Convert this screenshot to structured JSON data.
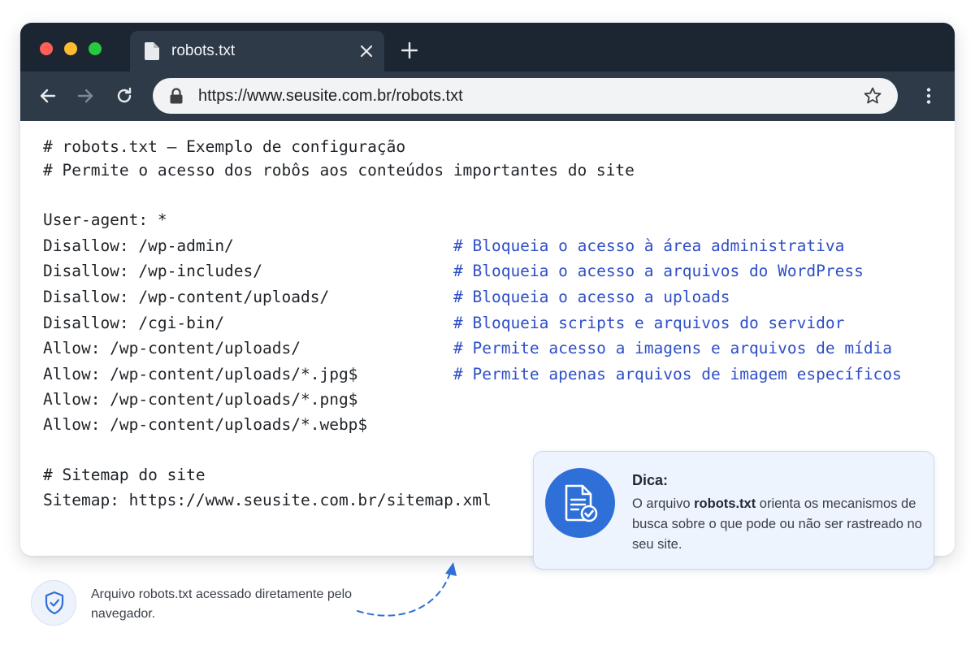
{
  "window": {
    "tab": {
      "title": "robots.txt",
      "icon": "file-icon"
    },
    "address_bar": {
      "url": "https://www.seusite.com.br/robots.txt"
    },
    "colors": {
      "titlebar": "#1c2632",
      "toolbar": "#2e3a48",
      "accent": "#2f6fd8"
    }
  },
  "file": {
    "lines": [
      {
        "code": "# robots.txt – Exemplo de configuração",
        "comment": ""
      },
      {
        "code": "# Permite o acesso dos robôs aos conteúdos importantes do site",
        "comment": ""
      },
      {
        "code": "User-agent: *",
        "comment": ""
      },
      {
        "code": "Disallow: /wp-admin/",
        "comment": "# Bloqueia o acesso à área administrativa"
      },
      {
        "code": "Disallow: /wp-includes/",
        "comment": "# Bloqueia o acesso a arquivos do WordPress"
      },
      {
        "code": "Disallow: /wp-content/uploads/",
        "comment": "# Bloqueia o acesso a uploads"
      },
      {
        "code": "Disallow: /cgi-bin/",
        "comment": "# Bloqueia scripts e arquivos do servidor"
      },
      {
        "code": "Allow: /wp-content/uploads/",
        "comment": "# Permite acesso a imagens e arquivos de mídia"
      },
      {
        "code": "Allow: /wp-content/uploads/*.jpg$",
        "comment": "# Permite apenas arquivos de imagem específicos"
      },
      {
        "code": "Allow: /wp-content/uploads/*.png$",
        "comment": ""
      },
      {
        "code": "Allow: /wp-content/uploads/*.webp$",
        "comment": ""
      },
      {
        "code": "# Sitemap do site",
        "comment": ""
      },
      {
        "code": "Sitemap: https://www.seusite.com.br/sitemap.xml",
        "comment": ""
      }
    ]
  },
  "tip": {
    "title": "Dica:",
    "body_prefix": "O arquivo ",
    "body_bold": "robots.txt",
    "body_suffix": " orienta os mecanismos de busca sobre o que pode ou não ser rastreado no seu site.",
    "icon": "document-check-icon"
  },
  "caption": {
    "text": "Arquivo robots.txt acessado diretamente pelo navegador.",
    "icon": "shield-check-icon"
  }
}
